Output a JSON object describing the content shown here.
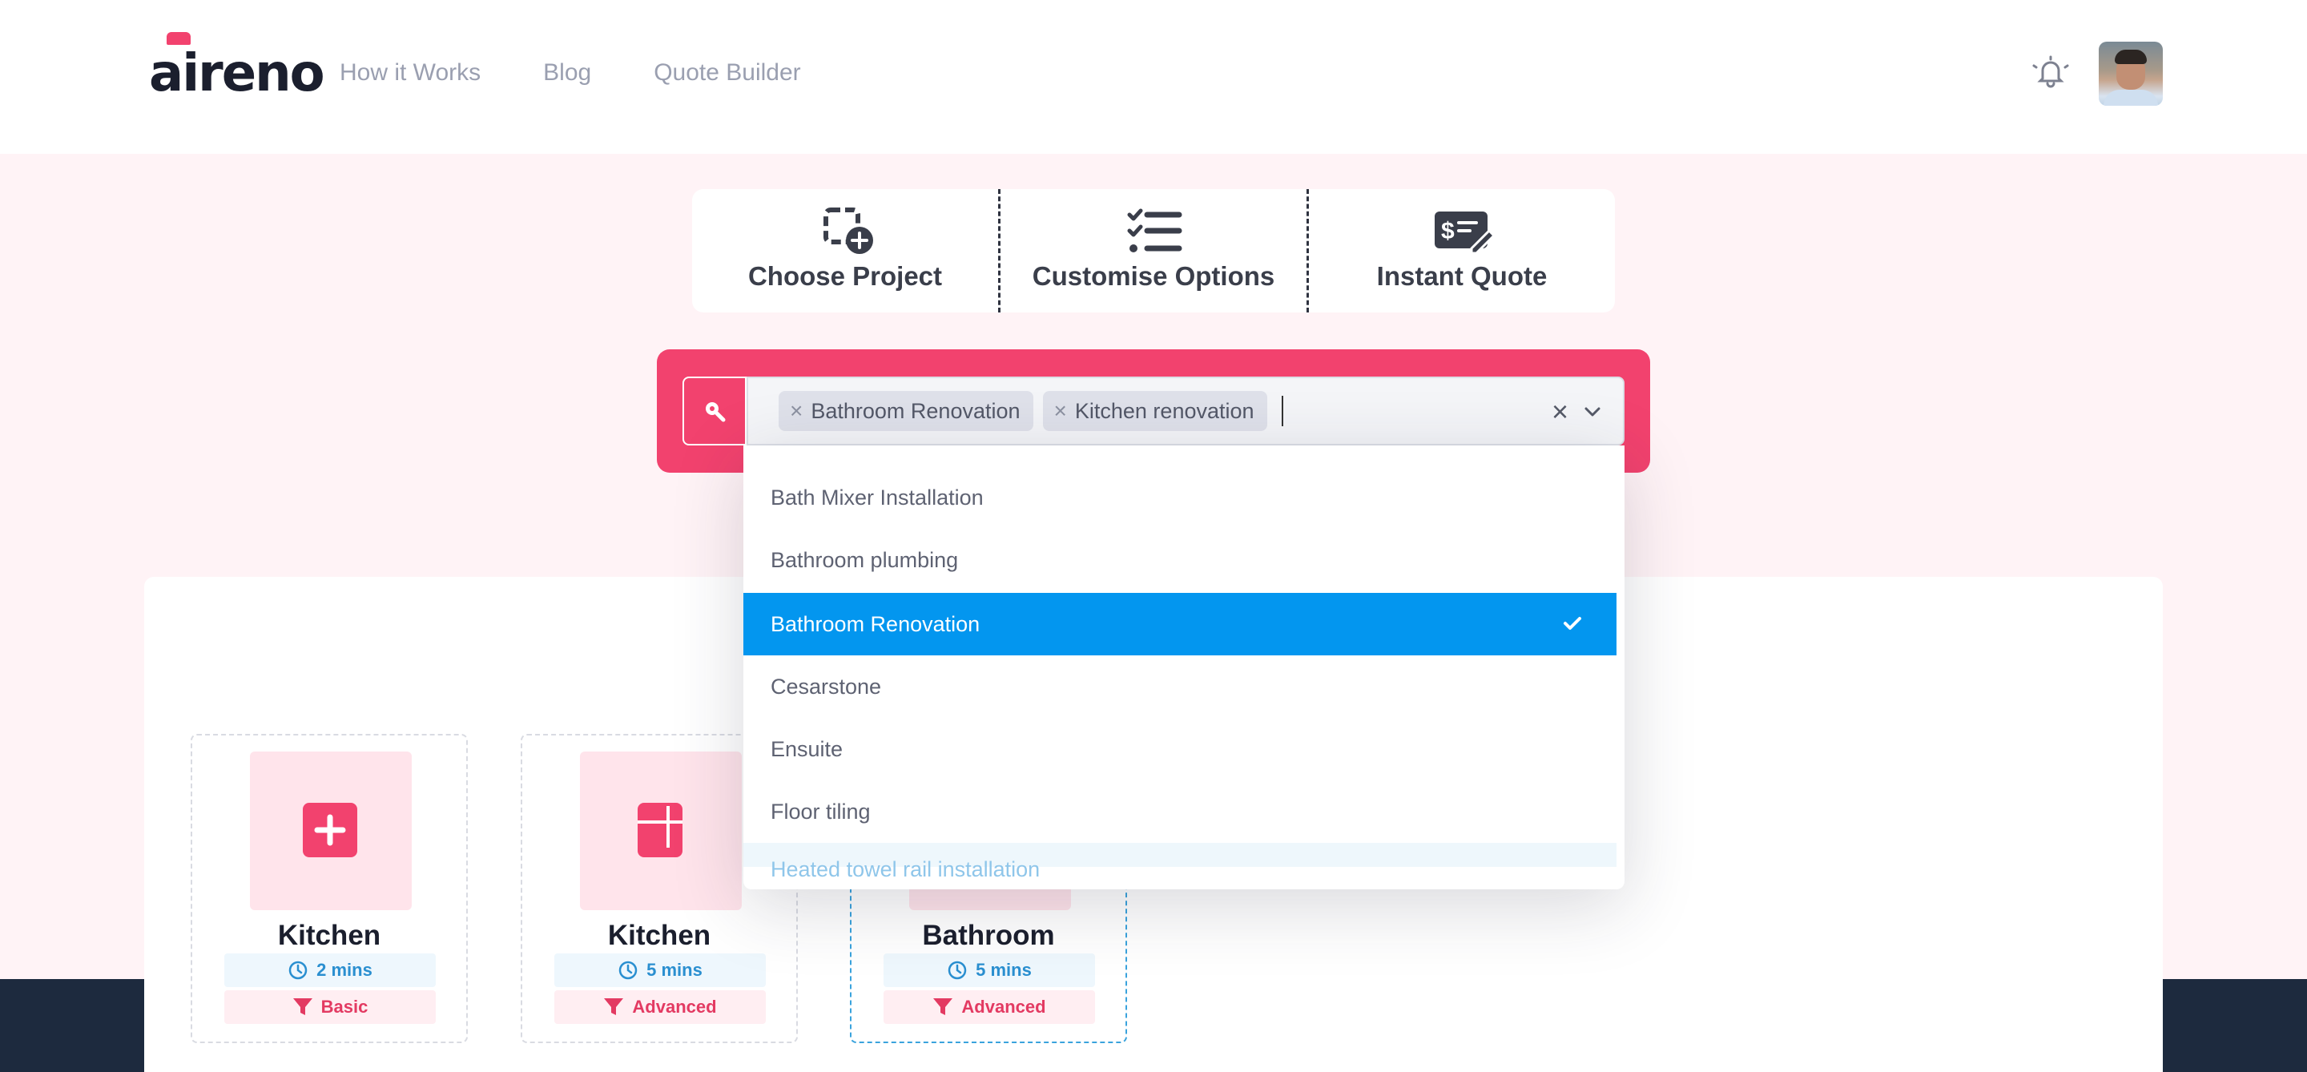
{
  "header": {
    "logo": "aireno",
    "nav": [
      "How it Works",
      "Blog",
      "Quote Builder"
    ]
  },
  "steps": [
    {
      "label": "Choose Project",
      "icon": "add-square-dashed-icon"
    },
    {
      "label": "Customise Options",
      "icon": "checklist-icon"
    },
    {
      "label": "Instant Quote",
      "icon": "quote-edit-icon"
    }
  ],
  "search": {
    "chips": [
      "Bathroom Renovation",
      "Kitchen renovation"
    ]
  },
  "dropdown": {
    "options": [
      "Bath Mixer Installation",
      "Bathroom plumbing",
      "Bathroom Renovation",
      "Cesarstone",
      "Ensuite",
      "Floor tiling",
      "Heated towel rail installation"
    ],
    "selected": "Bathroom Renovation"
  },
  "projects": [
    {
      "title": "Kitchen",
      "time": "2 mins",
      "level": "Basic"
    },
    {
      "title": "Kitchen",
      "time": "5 mins",
      "level": "Advanced"
    },
    {
      "title": "Bathroom",
      "time": "5 mins",
      "level": "Advanced"
    }
  ],
  "colors": {
    "brand": "#f2426e",
    "accent_blue": "#0396ef",
    "page_bg": "#fff3f6",
    "footer": "#1d2a3e"
  }
}
